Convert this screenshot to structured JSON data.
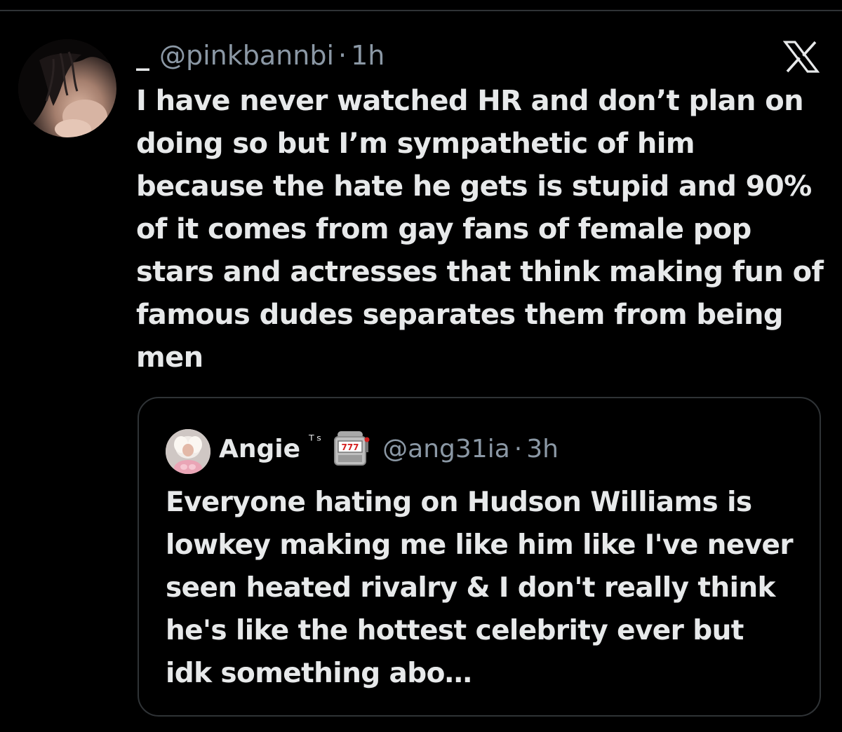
{
  "tweet": {
    "author": {
      "display_name": "_",
      "handle": "@pinkbannbi",
      "avatar_icon": "profile-photo-avatar"
    },
    "separator": "·",
    "time": "1h",
    "text": "I have never watched HR and don’t plan on doing so but I’m sympathetic of him because the hate he gets is stupid and 90% of it comes from gay fans of female pop stars and actresses that think making fun of famous dudes separates them from being men",
    "platform_logo": "x-logo-icon"
  },
  "quoted_tweet": {
    "author": {
      "display_name": "Angie",
      "name_suffix": "ᵀˢ",
      "emoji": "slot-machine-icon",
      "handle": "@ang31ia",
      "avatar_icon": "profile-photo-avatar"
    },
    "separator": "·",
    "time": "3h",
    "text": "Everyone hating on Hudson Williams is lowkey making me like him like I've never seen heated rivalry & I don't really think he's like the hottest celebrity ever but idk something abo…"
  },
  "colors": {
    "background": "#000000",
    "primary_text": "#e7e9ea",
    "secondary_text": "#8b98a5",
    "border": "#2f3336"
  }
}
